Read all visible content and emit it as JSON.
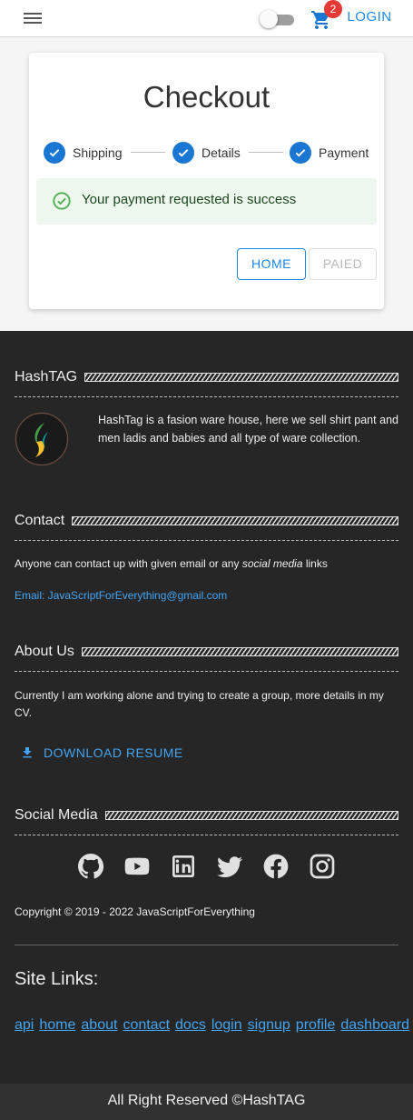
{
  "topbar": {
    "cart_count": "2",
    "login_label": "LOGIN"
  },
  "checkout": {
    "title": "Checkout",
    "steps": [
      {
        "label": "Shipping"
      },
      {
        "label": "Details"
      },
      {
        "label": "Payment"
      }
    ],
    "alert": "Your payment requested is success",
    "home_label": "HOME",
    "paied_label": "PAIED"
  },
  "footer": {
    "hashtag_title": "HashTAG",
    "hashtag_text": "HashTag is a fasion ware house, here we sell shirt pant and men ladis and babies and all type of ware collection.",
    "contact_title": "Contact",
    "contact_text_before": "Anyone can contact up with given email or any ",
    "contact_text_em": "social media",
    "contact_text_after": " links",
    "email": "Email: JavaScriptForEverything@gmail.com",
    "about_title": "About Us",
    "about_text": "Currently I am working alone and trying to create a group, more details in my CV.",
    "download_label": "DOWNLOAD RESUME",
    "social_title": "Social Media",
    "social_icons": [
      "github-icon",
      "youtube-icon",
      "linkedin-icon",
      "twitter-icon",
      "facebook-icon",
      "instagram-icon"
    ],
    "copyright": "Copyright © 2019 - 2022 JavaScriptForEverything",
    "sitelinks_title": "Site Links:",
    "links": [
      "api",
      "home",
      "about",
      "contact",
      "docs",
      "login",
      "signup",
      "profile",
      "dashboard"
    ],
    "bottom": "All Right Reserved ©HashTAG"
  },
  "colors": {
    "primary": "#1976d2",
    "link": "#42a5f5",
    "footer_bg": "#262626",
    "success_bg": "#edf7ed",
    "success_icon": "#4caf50",
    "badge": "#e53935"
  }
}
